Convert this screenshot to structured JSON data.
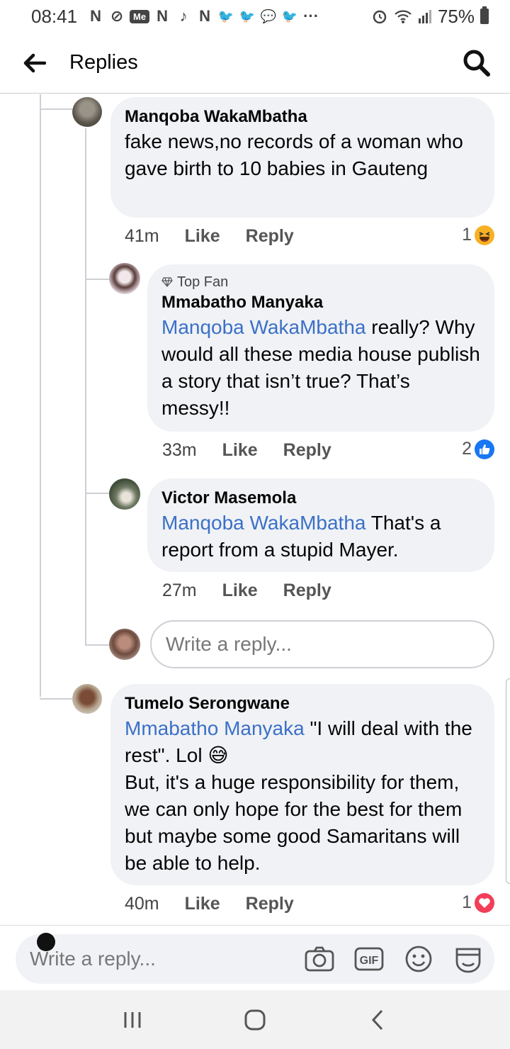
{
  "status_bar": {
    "time": "08:41",
    "notification_icons": [
      "N",
      "⊘",
      "Me",
      "N",
      "♪",
      "N",
      "🐦",
      "🐦",
      "💬",
      "🐦",
      "···"
    ],
    "battery": "75%"
  },
  "header": {
    "back_icon": "arrow-left-icon",
    "title": "Replies",
    "search_icon": "search-icon"
  },
  "comments": [
    {
      "author": "Manqoba WakaMbatha",
      "text": "fake news,no records of a woman who gave birth to 10 babies in Gauteng",
      "time": "41m",
      "like": "Like",
      "reply": "Reply",
      "reaction_count": "1",
      "reaction": "haha"
    },
    {
      "badge": "Top Fan",
      "author": "Mmabatho Manyaka",
      "mention": "Manqoba WakaMbatha",
      "text": " really? Why would all these media house publish a story that isn’t true? That’s messy!!",
      "time": "33m",
      "like": "Like",
      "reply": "Reply",
      "reaction_count": "2",
      "reaction": "like"
    },
    {
      "author": "Victor Masemola",
      "mention": "Manqoba WakaMbatha",
      "text": " That's a report from a stupid Mayer.",
      "time": "27m",
      "like": "Like",
      "reply": "Reply"
    },
    {
      "author": "Tumelo Serongwane",
      "mention": "Mmabatho Manyaka",
      "text_line1": " \"I will deal with the rest\". Lol 😅",
      "text_line2": "But, it's a huge responsibility for them, we can only hope for the best for them but maybe some good Samaritans will be able to help.",
      "time": "40m",
      "like": "Like",
      "reply": "Reply",
      "reaction_count": "1",
      "reaction": "love"
    }
  ],
  "inline_reply": {
    "placeholder": "Write a reply..."
  },
  "composer": {
    "placeholder": "Write a reply...",
    "tools": [
      "camera-icon",
      "gif-icon",
      "emoji-icon",
      "sticker-icon"
    ],
    "gif_label": "GIF"
  },
  "colors": {
    "mention": "#3b70c7",
    "bubble": "#f0f2f5",
    "like_blue": "#1877f2",
    "love_red": "#f33e58",
    "haha_yellow": "#f7b125"
  }
}
